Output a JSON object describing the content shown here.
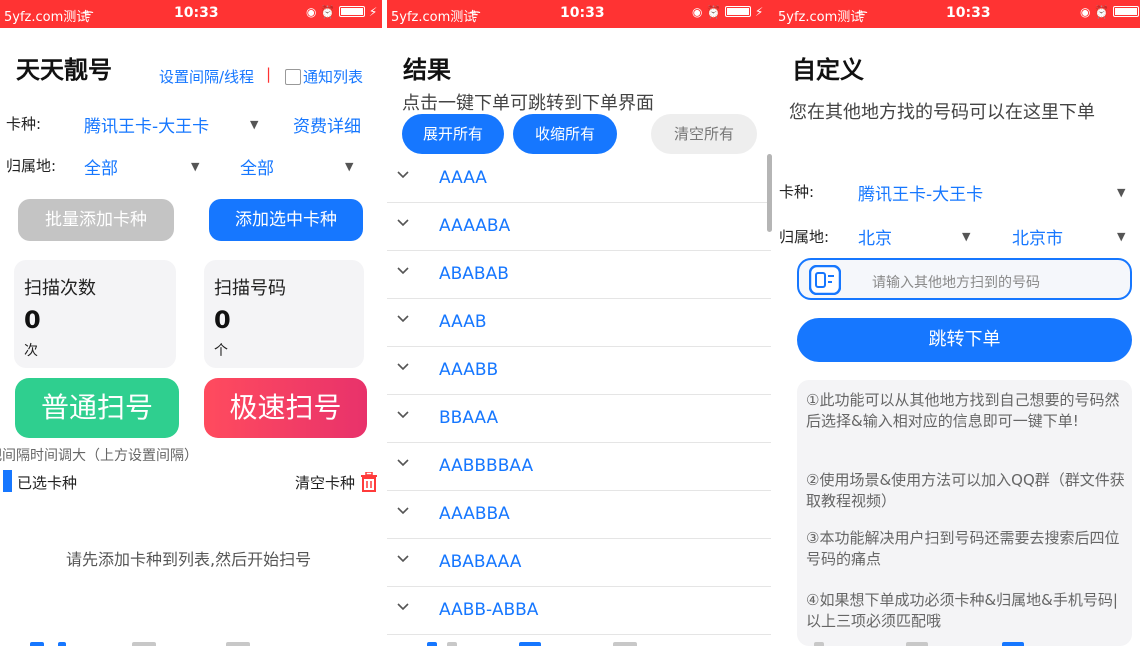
{
  "status_bar": {
    "carrier": "5yfz.com测试",
    "time": "10:33"
  },
  "panel1": {
    "title": "天天靓号",
    "settings_link": "设置间隔/线程",
    "divider": "|",
    "notify_label": "通知列表",
    "card_type_label": "卡种:",
    "card_type_value": "腾讯王卡-大王卡",
    "fee_details": "资费详细",
    "region_label": "归属地:",
    "province_value": "全部",
    "city_value": "全部",
    "batch_add_button": "批量添加卡种",
    "add_selected_button": "添加选中卡种",
    "scan_count_label": "扫描次数",
    "scan_count_value": "0",
    "scan_count_unit": "次",
    "scan_numbers_label": "扫描号码",
    "scan_numbers_value": "0",
    "scan_numbers_unit": "个",
    "normal_scan_button": "普通扫号",
    "fast_scan_button": "极速扫号",
    "interval_tip": "把间隔时间调大（上方设置间隔）",
    "selected_types_label": "已选卡种",
    "clear_types_label": "清空卡种",
    "empty_hint": "请先添加卡种到列表,然后开始扫号"
  },
  "panel2": {
    "title": "结果",
    "subtitle": "点击一键下单可跳转到下单界面",
    "expand_all": "展开所有",
    "collapse_all": "收缩所有",
    "clear_all": "清空所有",
    "results": [
      "AAAA",
      "AAAABA",
      "ABABAB",
      "AAAB",
      "AAABB",
      "BBAAA",
      "AABBBBAA",
      "AAABBA",
      "ABABAAA",
      "AABB-ABBA"
    ]
  },
  "panel3": {
    "title": "自定义",
    "subtitle": "您在其他地方找的号码可以在这里下单",
    "card_type_label": "卡种:",
    "card_type_value": "腾讯王卡-大王卡",
    "region_label": "归属地:",
    "province_value": "北京",
    "city_value": "北京市",
    "phone_placeholder": "请输入其他地方扫到的号码",
    "submit_button": "跳转下单",
    "notes": [
      "①此功能可以从其他地方找到自己想要的号码然后选择&输入相对应的信息即可一键下单!",
      "②使用场景&使用方法可以加入QQ群（群文件获取教程视频）",
      "③本功能解决用户扫到号码还需要去搜索后四位号码的痛点",
      "④如果想下单成功必须卡种&归属地&手机号码|以上三项必须匹配哦"
    ]
  },
  "colors": {
    "accent": "#1677ff",
    "status_bar": "#ff3333",
    "normal_scan": "#2fcf8f",
    "fast_scan": "#ff3b5c",
    "disabled": "#c4c4c4"
  }
}
